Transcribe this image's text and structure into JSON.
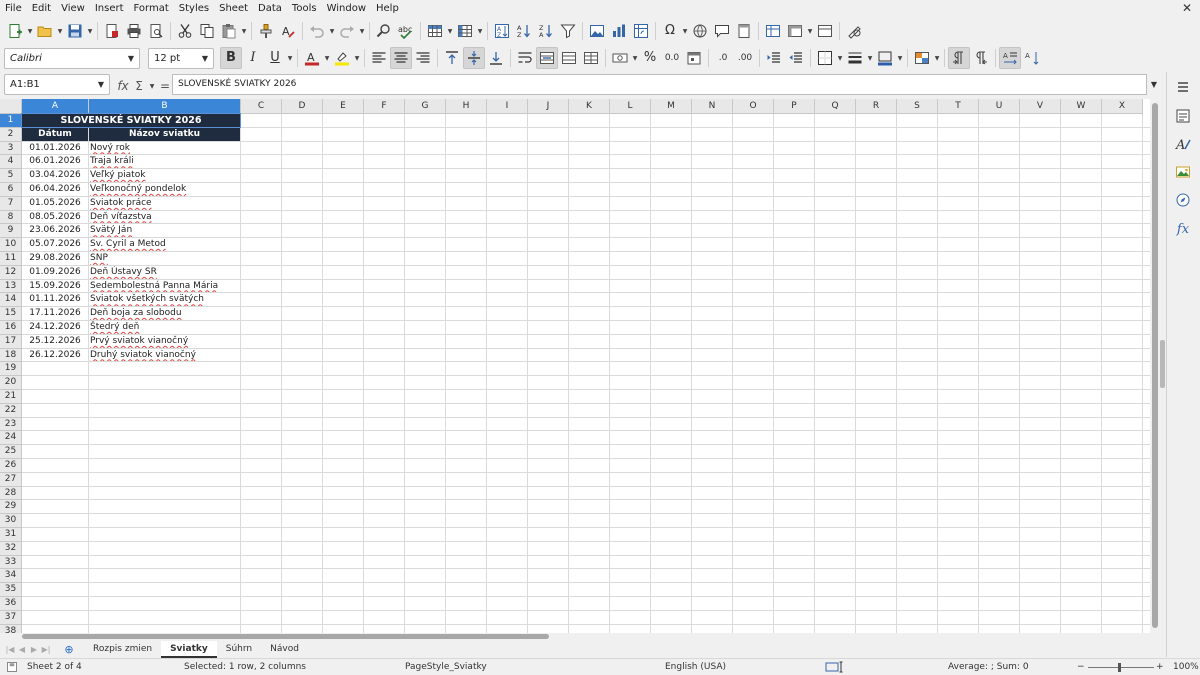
{
  "menu": [
    "File",
    "Edit",
    "View",
    "Insert",
    "Format",
    "Styles",
    "Sheet",
    "Data",
    "Tools",
    "Window",
    "Help"
  ],
  "toolbar": {
    "font_name": "Calibri",
    "font_size": "12 pt",
    "bold_label": "B",
    "italic_label": "I",
    "underline_label": "U",
    "percent_label": "%",
    "decimal_label": "0.0",
    "add_decimal_label": ".0",
    "remove_decimal_label": ".00"
  },
  "formula": {
    "cell_ref": "A1:B1",
    "content": "SLOVENSKÉ SVIATKY 2026",
    "fx_label": "fx",
    "sum_label": "Σ",
    "equals_label": "="
  },
  "columns": [
    "A",
    "B",
    "C",
    "D",
    "E",
    "F",
    "G",
    "H",
    "I",
    "J",
    "K",
    "L",
    "M",
    "N",
    "O",
    "P",
    "Q",
    "R",
    "S",
    "T",
    "U",
    "V",
    "W",
    "X"
  ],
  "rows": [
    "1",
    "2",
    "3",
    "4",
    "5",
    "6",
    "7",
    "8",
    "9",
    "10",
    "11",
    "12",
    "13",
    "14",
    "15",
    "16",
    "17",
    "18",
    "19",
    "20",
    "21",
    "22",
    "23",
    "24",
    "25",
    "26",
    "27",
    "28",
    "29",
    "30",
    "31",
    "32",
    "33",
    "34",
    "35",
    "36",
    "37",
    "38"
  ],
  "sheet": {
    "title": "SLOVENSKÉ SVIATKY 2026",
    "headers": [
      "Dátum",
      "Názov sviatku"
    ],
    "holidays": [
      [
        "01.01.2026",
        "Nový rok"
      ],
      [
        "06.01.2026",
        "Traja králi"
      ],
      [
        "03.04.2026",
        "Veľký piatok"
      ],
      [
        "06.04.2026",
        "Veľkonočný pondelok"
      ],
      [
        "01.05.2026",
        "Sviatok práce"
      ],
      [
        "08.05.2026",
        "Deň víťazstva"
      ],
      [
        "23.06.2026",
        "Svätý Ján"
      ],
      [
        "05.07.2026",
        "Sv. Cyril a Metod"
      ],
      [
        "29.08.2026",
        "SNP"
      ],
      [
        "01.09.2026",
        "Deň Ústavy SR"
      ],
      [
        "15.09.2026",
        "Sedembolestná Panna Mária"
      ],
      [
        "01.11.2026",
        "Sviatok všetkých svätých"
      ],
      [
        "17.11.2026",
        "Deň boja za slobodu"
      ],
      [
        "24.12.2026",
        "Štedrý deň"
      ],
      [
        "25.12.2026",
        "Prvý sviatok vianočný"
      ],
      [
        "26.12.2026",
        "Druhý sviatok vianočný"
      ]
    ]
  },
  "tabs": [
    "Rozpis zmien",
    "Sviatky",
    "Súhrn",
    "Návod"
  ],
  "active_tab": "Sviatky",
  "status": {
    "sheet_info": "Sheet 2 of 4",
    "selection": "Selected: 1 row, 2 columns",
    "page_style": "PageStyle_Sviatky",
    "language": "English (USA)",
    "summary": "Average: ; Sum: 0",
    "zoom": "100%"
  },
  "colors": {
    "header_bg": "#1f2b3e",
    "selection": "#3c86d8"
  }
}
